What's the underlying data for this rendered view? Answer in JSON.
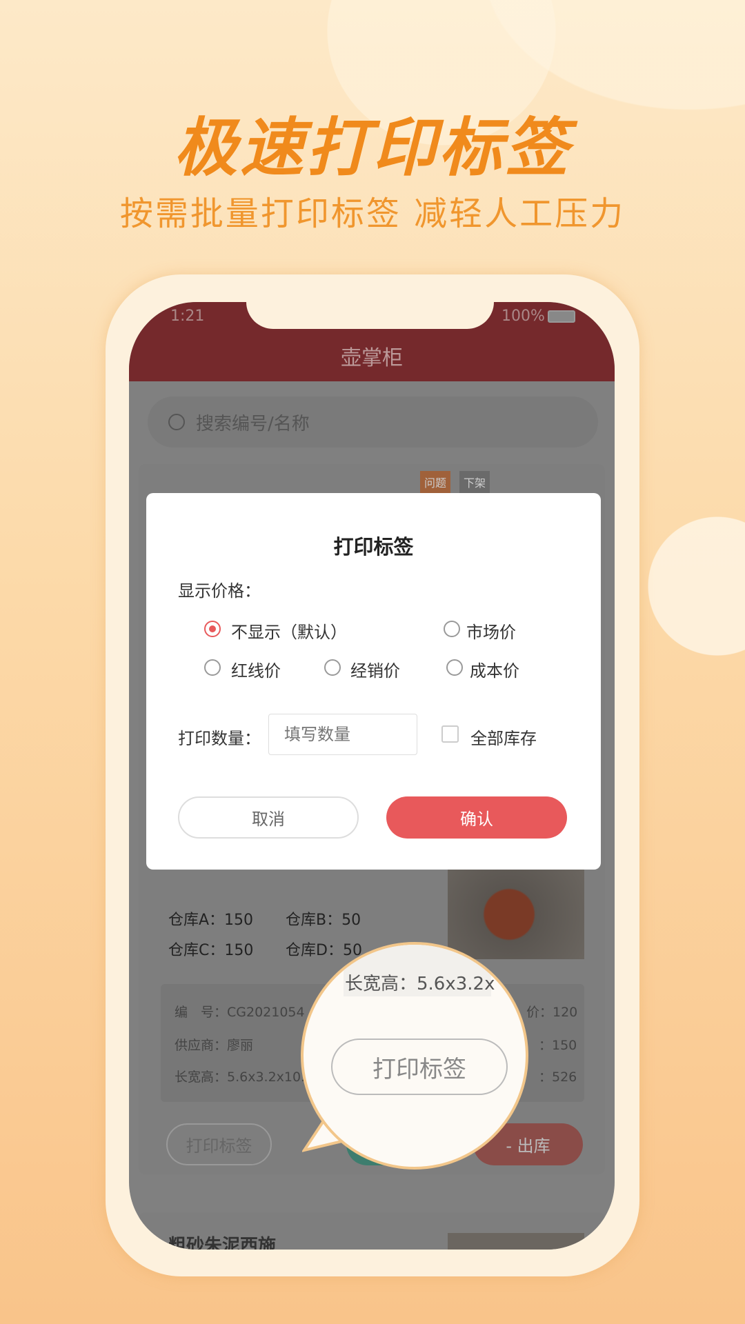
{
  "promo": {
    "title": "极速打印标签",
    "subtitle": "按需批量打印标签 减轻人工压力"
  },
  "status_bar": {
    "time": "1:21",
    "battery": "100%"
  },
  "app": {
    "title": "壶掌柜",
    "search_placeholder": "搜索编号/名称"
  },
  "product": {
    "tags": [
      "问题",
      "下架"
    ],
    "stock": [
      "仓库A：150",
      "仓库B：50",
      "仓库C：150",
      "仓库D：50"
    ],
    "info_left": [
      "编　号：CG2021054",
      "供应商：廖丽",
      "长宽高：5.6x3.2x10."
    ],
    "info_right": [
      "价：120",
      "：150",
      "：526"
    ],
    "print_button": "打印标签",
    "out_button": "- 出库"
  },
  "next_product": {
    "title": "粗砂朱泥西施"
  },
  "dialog": {
    "title": "打印标签",
    "price_label": "显示价格：",
    "options": [
      {
        "label": "不显示（默认）",
        "selected": true
      },
      {
        "label": "市场价",
        "selected": false
      },
      {
        "label": "红线价",
        "selected": false
      },
      {
        "label": "经销价",
        "selected": false
      },
      {
        "label": "成本价",
        "selected": false
      }
    ],
    "qty_label": "打印数量：",
    "qty_placeholder": "填写数量",
    "all_stock_label": "全部库存",
    "all_stock_checked": false,
    "cancel": "取消",
    "confirm": "确认"
  },
  "magnifier": {
    "text": "长宽高：5.6x3.2x",
    "button": "打印标签"
  },
  "colors": {
    "header": "#75292c",
    "confirm": "#e8595b",
    "accent": "#f08a1c"
  }
}
